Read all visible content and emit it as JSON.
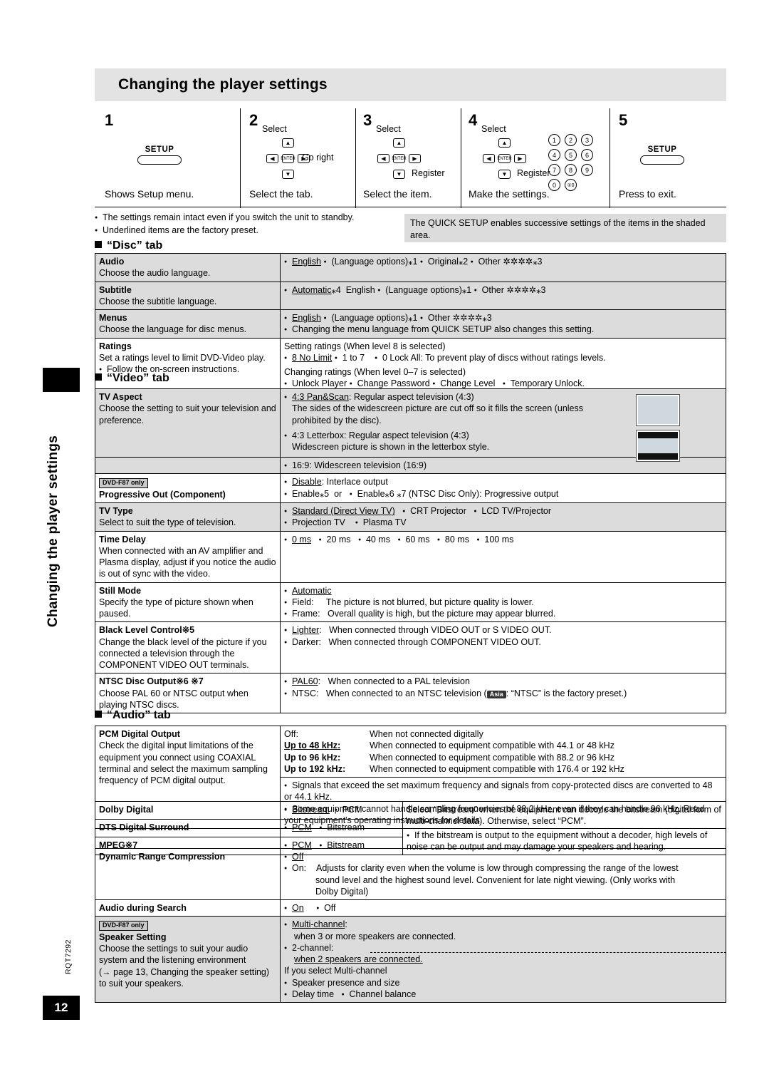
{
  "page": {
    "title": "Changing the player settings",
    "side_title": "Changing the player settings",
    "page_number": "12",
    "doc_code": "RQT7292"
  },
  "steps": [
    {
      "num": "1",
      "caption": "Shows Setup menu.",
      "sub": "",
      "button": "SETUP"
    },
    {
      "num": "2",
      "caption": "Select the tab.",
      "sub": "Select",
      "extra": "Go right"
    },
    {
      "num": "3",
      "caption": "Select the item.",
      "sub": "Select",
      "extra": "Register"
    },
    {
      "num": "4",
      "caption": "Make the settings.",
      "sub": "Select",
      "extra": "Register"
    },
    {
      "num": "5",
      "caption": "Press to exit.",
      "sub": "",
      "button": "SETUP"
    }
  ],
  "notes": [
    "The settings remain intact even if you switch the unit to standby.",
    "Underlined items are the factory preset."
  ],
  "quick_setup_note": "The QUICK SETUP enables successive settings of the items in the shaded area.",
  "sections": {
    "disc": "“Disc” tab",
    "video": "“Video” tab",
    "audio": "“Audio” tab"
  },
  "disc_rows": [
    {
      "name": "Audio",
      "desc": "Choose the audio language.",
      "right": "English   (Language options)※1   Original※2   Other ✲✲✲✲※3",
      "shaded": true
    },
    {
      "name": "Subtitle",
      "desc": "Choose the subtitle language.",
      "right": "Automatic※4  English   (Language options)※1   Other ✲✲✲✲※3",
      "shaded": true
    },
    {
      "name": "Menus",
      "desc": "Choose the language for disc menus.",
      "right": "English   (Language options)※1   Other ✲✲✲✲※3",
      "right2": "Changing the menu language from QUICK SETUP also changes this setting.",
      "shaded": true
    },
    {
      "name": "Ratings",
      "desc": "Set a ratings level to limit DVD-Video play.",
      "desc2": "Follow the on-screen instructions.",
      "lines": [
        "Setting ratings (When level 8 is selected)",
        "8 No Limit     1 to 7       0 Lock All: To prevent play of discs without ratings levels.",
        "Changing ratings (When level 0–7 is selected)",
        "Unlock Player     Change Password     Change Level       Temporary Unlock."
      ],
      "shaded": false
    }
  ],
  "video_rows": [
    {
      "name": "TV Aspect",
      "desc": "Choose the setting to suit your television and preference.",
      "lines": [
        "4:3 Pan&Scan: Regular aspect television (4:3)",
        "The sides of the widescreen picture are cut off so it fills the screen (unless prohibited by the disc).",
        "4:3 Letterbox: Regular aspect television (4:3)",
        "Widescreen picture is shown in the letterbox style."
      ],
      "shaded": true
    },
    {
      "name": "",
      "desc": "",
      "lines": [
        "16:9: Widescreen television (16:9)"
      ],
      "shaded": true
    },
    {
      "tag": "DVD-F87 only",
      "name": "Progressive Out (Component)",
      "desc": "",
      "lines": [
        "Disable: Interlace output",
        "Enable※5  or    Enable※6 ※7 (NTSC Disc Only): Progressive output"
      ],
      "shaded": false
    },
    {
      "name": "TV Type",
      "desc": "Select to suit the type of television.",
      "lines": [
        "Standard (Direct View TV)        CRT Projector        LCD TV/Projector",
        "Projection TV          Plasma TV"
      ],
      "shaded": true
    },
    {
      "name": "Time Delay",
      "desc": "When connected with an AV amplifier and Plasma display, adjust if you notice the audio is out of sync with the video.",
      "lines": [
        "0 ms      20 ms      40 ms      60 ms      80 ms      100 ms"
      ],
      "shaded": false
    },
    {
      "name": "Still Mode",
      "desc": "Specify the type of picture shown when paused.",
      "lines": [
        "Automatic",
        "Field:     The picture is not blurred, but picture quality is lower.",
        "Frame:   Overall quality is high, but the picture may appear blurred."
      ],
      "shaded": false
    },
    {
      "name": "Black Level Control※5",
      "desc": "Change the black level of the picture if you connected a television through the COMPONENT VIDEO OUT terminals.",
      "lines": [
        "Lighter:   When connected through VIDEO OUT or S VIDEO OUT.",
        "Darker:   When connected through COMPONENT VIDEO OUT."
      ],
      "shaded": false
    },
    {
      "name": "NTSC Disc Output※6 ※7",
      "desc": "Choose PAL 60 or NTSC output when playing NTSC discs.",
      "lines": [
        "PAL60:   When connected to a PAL television",
        "NTSC:   When connected to an NTSC television ( Asia : “NTSC” is the factory preset.)"
      ],
      "shaded": false
    }
  ],
  "audio": {
    "pcm": {
      "name": "PCM Digital Output",
      "desc": "Check the digital input limitations of the equipment you connect using COAXIAL terminal and select the maximum sampling frequency of PCM digital output.",
      "options": [
        {
          "label": "Off:",
          "text": "When not connected digitally"
        },
        {
          "label": "Up to 48 kHz:",
          "text": "When connected to equipment compatible with 44.1 or 48 kHz"
        },
        {
          "label": "Up to 96 kHz:",
          "text": "When connected to equipment compatible with 88.2 or 96 kHz"
        },
        {
          "label": "Up to 192 kHz:",
          "text": "When connected to equipment compatible with 176.4 or 192 kHz"
        }
      ],
      "notes": [
        "Signals that exceed the set maximum frequency and signals from copy-protected discs are converted to 48 or 44.1 kHz.",
        "Some equipment cannot handle sampling frequencies of 88.2 kHz, even if they can handle 96 kHz. Read your equipment's operating instructions for details."
      ]
    },
    "stream_rows": [
      {
        "name": "Dolby Digital",
        "opts": "Bitstream    PCM"
      },
      {
        "name": "DTS Digital Surround",
        "opts": "PCM      Bitstream"
      },
      {
        "name": "MPEG※7",
        "opts": "PCM      Bitstream"
      }
    ],
    "stream_note1": "Select “Bitstream” when the equipment can decode the bitstream (digital form of multi-channel data). Otherwise, select “PCM”.",
    "stream_note2": "If the bitstream is output to the equipment without a decoder, high levels of noise can be output and may damage your speakers and hearing.",
    "drc": {
      "name": "Dynamic Range Compression",
      "lines": [
        "Off",
        "On:      Adjusts for clarity even when the volume is low through compressing the range of the lowest sound level and the highest sound level. Convenient for late night viewing. (Only works with Dolby Digital)"
      ]
    },
    "search": {
      "name": "Audio during Search",
      "opts": "On        Off"
    },
    "speaker": {
      "tag": "DVD-F87 only",
      "name": "Speaker Setting",
      "desc": "Choose the settings to suit your audio system and the listening environment (→ page 13, Changing the speaker setting) to suit your speakers.",
      "lines": [
        "Multi-channel:",
        "when 3 or more speakers are connected.",
        "2-channel:",
        "when 2 speakers are connected."
      ],
      "sub": [
        "If you select Multi-channel",
        "Speaker presence and size",
        "Delay time    Channel balance"
      ]
    }
  }
}
